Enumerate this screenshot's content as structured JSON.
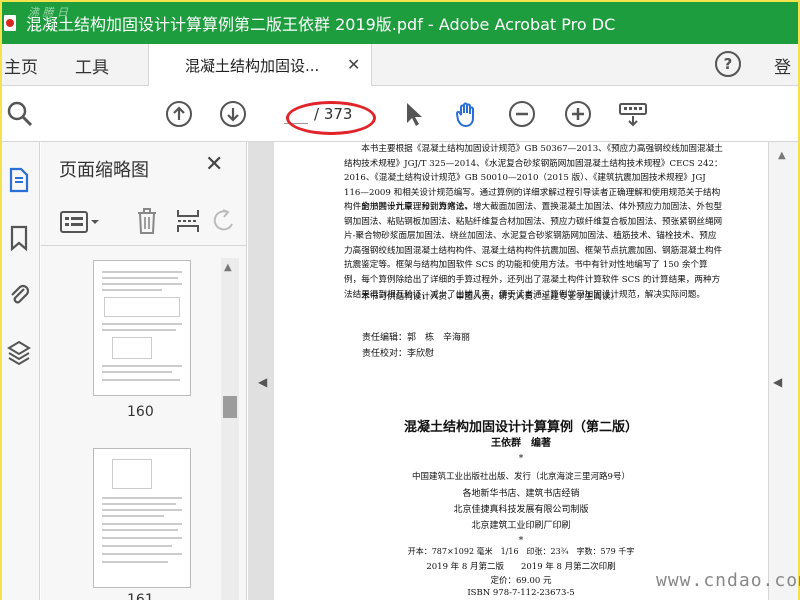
{
  "window": {
    "title": "混凝土结构加固设计计算算例第二版王依群 2019版.pdf - Adobe Acrobat Pro DC",
    "corner_watermark": "沸 腾 日"
  },
  "tabs": {
    "home": "主页",
    "tools": "工具",
    "document_tab": "混凝土结构加固设...",
    "signin": "登"
  },
  "toolbar": {
    "page_current": "",
    "page_total": "/ 373",
    "icons": [
      "search-icon",
      "page-up-icon",
      "page-down-icon",
      "select-cursor-icon",
      "hand-tool-icon",
      "zoom-out-icon",
      "zoom-in-icon",
      "keyboard-icon"
    ]
  },
  "thumbnails": {
    "title": "页面缩略图",
    "pages": [
      {
        "label": "160"
      },
      {
        "label": "161"
      }
    ]
  },
  "document": {
    "paragraphs": [
      "本书主要根据《混凝土结构加固设计规范》GB 50367—2013、《预应力高强钢绞线加固混凝土结构技术规程》JGJ/T 325—2014、《水泥复合砂浆钢筋网加固混凝土结构技术规程》CECS 242：2016、《混凝土结构设计规范》GB 50010—2010（2015 版）、《建筑抗震加固技术规程》JGJ 116—2009 和相关设计规范编写。通过算例的详细求解过程引导读者正确理解和使用规范关于结构构件的加固设计原理和计算方法。",
      "全书共十九章，分别为绪论、增大截面加固法、置换混凝土加固法、体外预应力加固法、外包型钢加固法、粘贴钢板加固法、粘贴纤维复合材加固法、预应力碳纤维复合板加固法、预张紧钢丝绳网片-聚合物砂浆面层加固法、绕丝加固法、水泥复合砂浆钢筋网加固法、植筋技术、锚栓技术、预应力高强钢绞线加固混凝土结构构件、混凝土结构构件抗震加固、框架节点抗震加固、钢筋混凝土构件抗震鉴定等。框架与结构加固软件 SCS 的功能和使用方法。书中有针对性地编写了 150 余个算例，每个算例除给出了详细的手算过程外，还列出了混凝土构件计算软件 SCS 的计算结果，两种方法结果得到相互验证，减少了出错几率，便于读者通过算例学习加固设计规范，解决实际问题。",
      "本书可供结构设计人员、审图人员、研究人员、土建专业学生阅读。"
    ],
    "editors": "责任编辑：郭　栋　辛海丽",
    "proofreader": "责任校对：李欣慰",
    "book_title": "混凝土结构加固设计计算算例（第二版）",
    "author": "王依群　编著",
    "star": "*",
    "publisher": "中国建筑工业出版社出版、发行（北京海淀三里河路9号）",
    "distributor": "各地新华书店、建筑书店经销",
    "typesetter": "北京佳捷真科技发展有限公司制版",
    "printer": "北京建筑工业印刷厂印刷",
    "star2": "*",
    "format": "开本：787×1092 毫米　1/16　印张：23¾　字数：579 千字",
    "edition": "2019 年 8 月第二版　　2019 年 8 月第二次印刷",
    "price": "定价：69.00 元",
    "isbn": "ISBN 978-7-112-23673-5"
  },
  "site_watermark": "www.cndao.com"
}
